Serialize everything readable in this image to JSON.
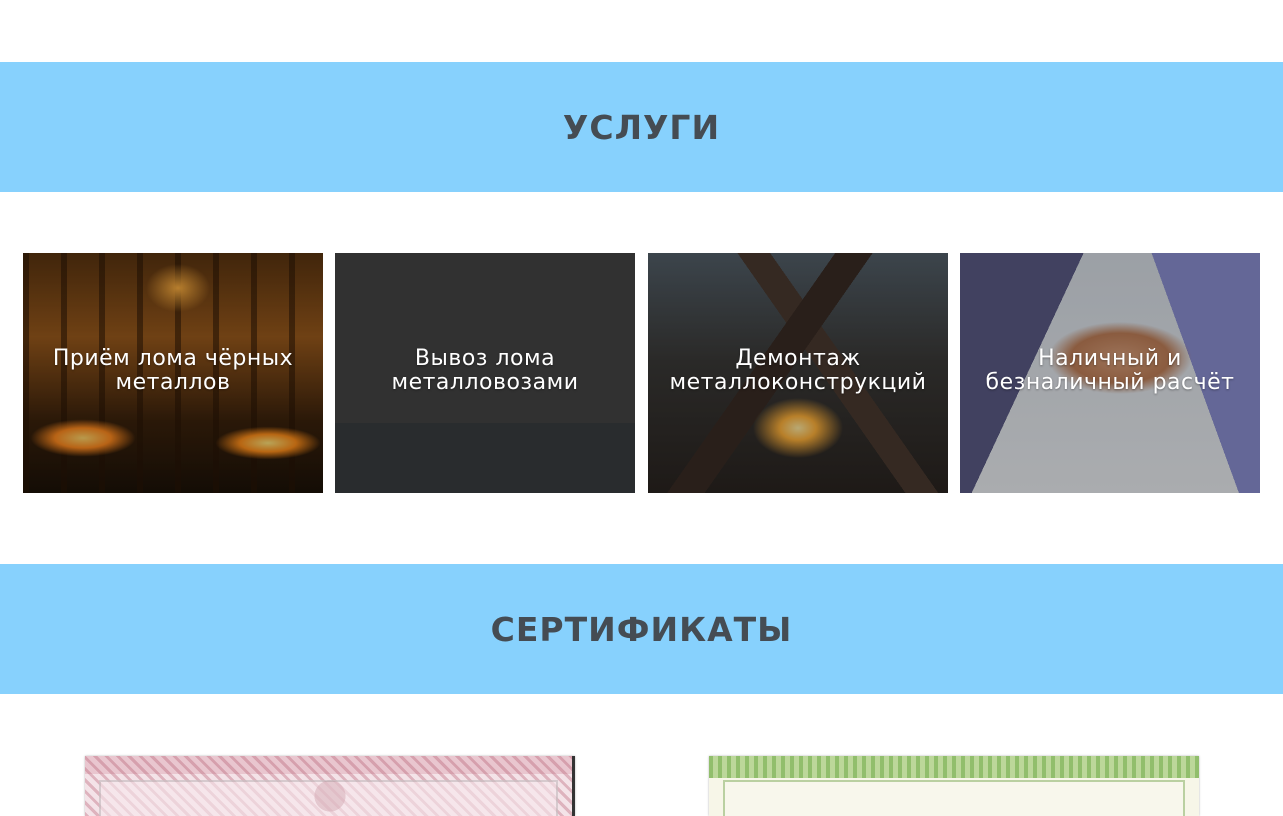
{
  "services": {
    "heading": "УСЛУГИ",
    "items": [
      {
        "title": "Приём лома чёрных металлов",
        "image": "furnace-photo"
      },
      {
        "title": "Вывоз лома металловозами",
        "image": "truck-photo"
      },
      {
        "title": "Демонтаж металлоконструкций",
        "image": "demolition-photo"
      },
      {
        "title": "Наличный и безналичный расчёт",
        "image": "handshake-photo"
      }
    ]
  },
  "certificates": {
    "heading": "СЕРТИФИКАТЫ",
    "items": [
      {
        "image": "certificate-red-document"
      },
      {
        "image": "certificate-green-document"
      }
    ]
  },
  "colors": {
    "band": "#87d1fd",
    "heading_text": "#454c53",
    "card_text": "#ffffff",
    "background": "#ffffff"
  }
}
